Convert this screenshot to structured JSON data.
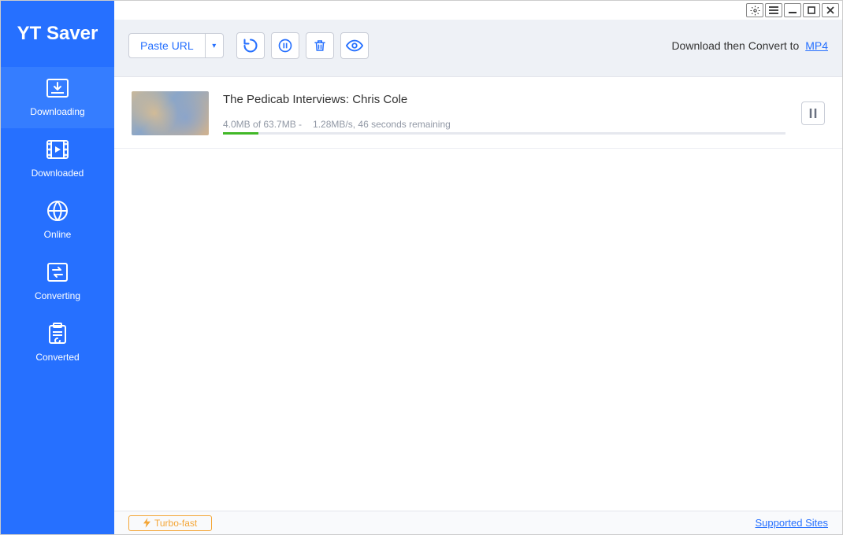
{
  "app_name": "YT Saver",
  "sidebar": {
    "items": [
      {
        "label": "Downloading"
      },
      {
        "label": "Downloaded"
      },
      {
        "label": "Online"
      },
      {
        "label": "Converting"
      },
      {
        "label": "Converted"
      }
    ]
  },
  "toolbar": {
    "paste_url": "Paste URL",
    "download_text": "Download then Convert to",
    "format": "MP4"
  },
  "download": {
    "title": "The Pedicab Interviews: Chris Cole",
    "stats_left": "4.0MB of 63.7MB -",
    "stats_right": "1.28MB/s, 46 seconds remaining",
    "progress_pct": 6.3
  },
  "footer": {
    "turbo": "Turbo-fast",
    "supported": "Supported Sites"
  }
}
